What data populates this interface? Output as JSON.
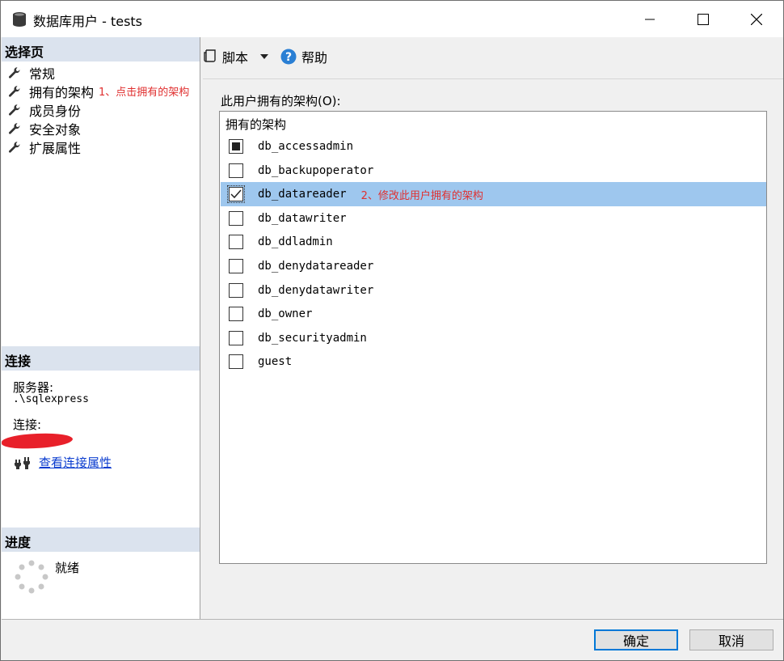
{
  "window": {
    "title": "数据库用户 - tests",
    "minimize_symbol": "—",
    "maximize_symbol": "☐",
    "close_symbol": "✕"
  },
  "select_page": {
    "header": "选择页",
    "items": [
      {
        "label": "常规",
        "icon": "wrench-icon"
      },
      {
        "label": "拥有的架构",
        "icon": "wrench-icon",
        "annotation": "1、点击拥有的架构"
      },
      {
        "label": "成员身份",
        "icon": "wrench-icon"
      },
      {
        "label": "安全对象",
        "icon": "wrench-icon"
      },
      {
        "label": "扩展属性",
        "icon": "wrench-icon"
      }
    ]
  },
  "connection": {
    "header": "连接",
    "server_label": "服务器:",
    "server_value": ".\\sqlexpress",
    "connection_label": "连接:",
    "view_properties_link": "查看连接属性"
  },
  "progress": {
    "header": "进度",
    "status": "就绪"
  },
  "toolbar": {
    "script_label": "脚本",
    "help_label": "帮助"
  },
  "schemas": {
    "caption": "此用户拥有的架构(O):",
    "column_header": "拥有的架构",
    "annotation": "2、修改此用户拥有的架构",
    "items": [
      {
        "name": "db_accessadmin",
        "state": "indeterminate"
      },
      {
        "name": "db_backupoperator",
        "state": "unchecked"
      },
      {
        "name": "db_datareader",
        "state": "checked"
      },
      {
        "name": "db_datawriter",
        "state": "unchecked"
      },
      {
        "name": "db_ddladmin",
        "state": "unchecked"
      },
      {
        "name": "db_denydatareader",
        "state": "unchecked"
      },
      {
        "name": "db_denydatawriter",
        "state": "unchecked"
      },
      {
        "name": "db_owner",
        "state": "unchecked"
      },
      {
        "name": "db_securityadmin",
        "state": "unchecked"
      },
      {
        "name": "guest",
        "state": "unchecked"
      }
    ]
  },
  "buttons": {
    "ok": "确定",
    "cancel": "取消"
  },
  "colors": {
    "selection": "#9ec7ee",
    "section_header": "#dbe3ee",
    "annotation": "#e03030",
    "link": "#0a3ccf"
  }
}
